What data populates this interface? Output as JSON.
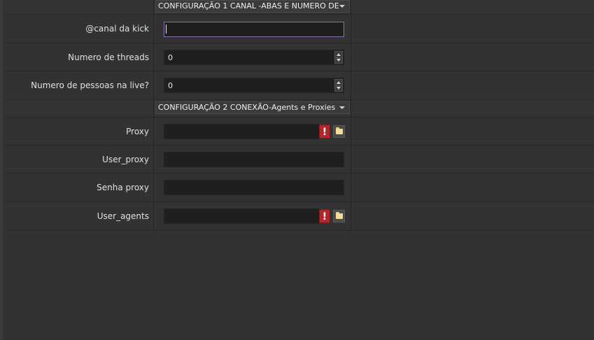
{
  "sections": [
    {
      "title": "CONFIGURAÇÃO 1 CANAL -ABAS E NUMERO DE",
      "fields": [
        {
          "label": "@canal da kick",
          "type": "text",
          "value": ""
        },
        {
          "label": "Numero de threads",
          "type": "spin",
          "value": "0"
        },
        {
          "label": "Numero de pessoas na live?",
          "type": "spin",
          "value": "0"
        }
      ]
    },
    {
      "title": "CONFIGURAÇÃO 2 CONEXÃO-Agents e Proxies",
      "fields": [
        {
          "label": "Proxy",
          "type": "file",
          "value": "",
          "warning": "!"
        },
        {
          "label": "User_proxy",
          "type": "text",
          "value": ""
        },
        {
          "label": "Senha proxy",
          "type": "text",
          "value": ""
        },
        {
          "label": "User_agents",
          "type": "file",
          "value": "",
          "warning": "!"
        }
      ]
    }
  ],
  "colors": {
    "background": "#323232",
    "input_bg": "#1f1f1f",
    "focus_border": "#8c6fb0",
    "warning": "#b3262b",
    "folder": "#f0dc9c"
  },
  "icons": {
    "warning": "exclamation-warning-icon",
    "browse": "folder-icon",
    "dropdown": "chevron-down-icon",
    "spin": "spin-up-down-icon"
  }
}
